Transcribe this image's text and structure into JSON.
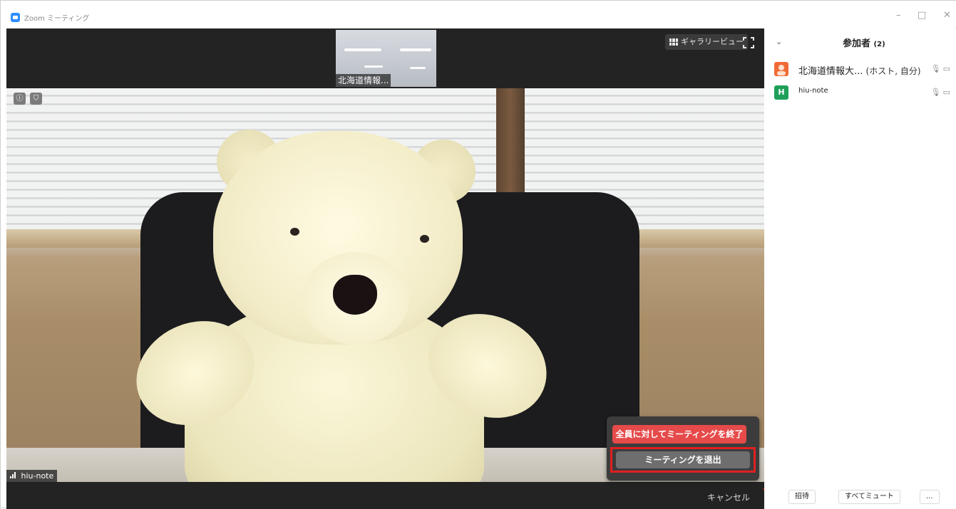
{
  "window": {
    "title": "Zoom ミーティング",
    "minimize_glyph": "–",
    "maximize_glyph": "□",
    "close_glyph": "✕"
  },
  "video": {
    "thumbnail_name": "北海道情報...",
    "gallery_view_label": "ギャラリービュー",
    "info_glyph": "ⓘ",
    "shield_glyph": "⛉",
    "speaker_name": "hiu-note"
  },
  "end_menu": {
    "end_all_label": "全員に対してミーティングを終了",
    "leave_label": "ミーティングを退出",
    "cancel_label": "キャンセル"
  },
  "participants_panel": {
    "title": "参加者",
    "count": "(2)",
    "collapse_glyph": "⌄",
    "participants": [
      {
        "name": "北海道情報大...",
        "role": "(ホスト, 自分)",
        "avatar_letter": "",
        "avatar_color": "#f06a35"
      },
      {
        "name": "hiu-note",
        "role": "",
        "avatar_letter": "H",
        "avatar_color": "#1fa05a"
      }
    ],
    "footer": {
      "invite_label": "招待",
      "mute_all_label": "すべてミュート",
      "more_label": "..."
    }
  },
  "colors": {
    "end_all_button": "#e64a4a",
    "highlight_border": "#e02020",
    "zoom_blue": "#2d8cff"
  }
}
